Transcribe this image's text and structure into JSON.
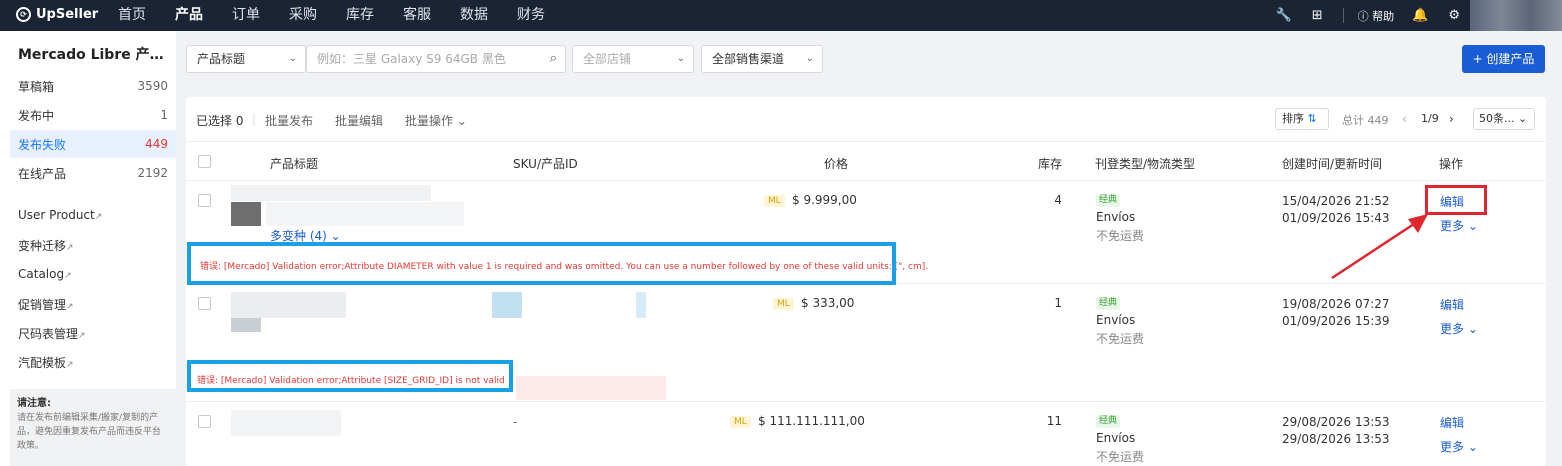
{
  "app": {
    "logo_text": "UpSeller"
  },
  "nav": {
    "items": [
      "首页",
      "产品",
      "订单",
      "采购",
      "库存",
      "客服",
      "数据",
      "财务"
    ],
    "active": "产品"
  },
  "topbar": {
    "help_label": "帮助"
  },
  "sidebar": {
    "title": "Mercado Libre 产…",
    "items": [
      {
        "label": "草稿箱",
        "count": "3590"
      },
      {
        "label": "发布中",
        "count": "1"
      },
      {
        "label": "发布失败",
        "count": "449"
      },
      {
        "label": "在线产品",
        "count": "2192"
      }
    ],
    "links": [
      "User Product",
      "变种迁移",
      "Catalog",
      "促销管理",
      "尺码表管理",
      "汽配模板"
    ],
    "notice_title": "请注意:",
    "notice_text": "请在发布前编辑采集/搬家/复制的产品，避免因重复发布产品而违反平台政策。"
  },
  "filters": {
    "field_select": "产品标题",
    "search_placeholder": "例如：三星 Galaxy S9 64GB 黑色",
    "shop_select": "全部店铺",
    "channel_select": "全部销售渠道"
  },
  "create_button": "+ 创建产品",
  "toolbar": {
    "selected_label": "已选择",
    "selected_count": "0",
    "batch_publish": "批量发布",
    "batch_edit": "批量编辑",
    "batch_ops": "批量操作",
    "sort_label": "排序",
    "total": "总计 449",
    "page": "1/9",
    "page_size": "50条..."
  },
  "table": {
    "headers": [
      "产品标题",
      "SKU/产品ID",
      "价格",
      "库存",
      "刊登类型/物流类型",
      "创建时间/更新时间",
      "操作"
    ],
    "rows": [
      {
        "ml": "ML",
        "price": "$ 9.999,00",
        "stock": "4",
        "type_tag": "经典",
        "logistics": "Envíos",
        "shipping": "不免运费",
        "created": "15/04/2026 21:52",
        "updated": "01/09/2026 15:43",
        "edit": "编辑",
        "more": "更多",
        "variants": "多变种 (4)",
        "sku": "",
        "error": "错误: [Mercado] Validation error;Attribute DIAMETER with value 1 is required and was omitted. You can use a number followed by one of these valid units: [\", cm]."
      },
      {
        "ml": "ML",
        "price": "$ 333,00",
        "stock": "1",
        "type_tag": "经典",
        "logistics": "Envíos",
        "shipping": "不免运费",
        "created": "19/08/2026 07:27",
        "updated": "01/09/2026 15:39",
        "edit": "编辑",
        "more": "更多",
        "variants": "",
        "sku": "",
        "error": "错误: [Mercado] Validation error;Attribute [SIZE_GRID_ID] is not valid"
      },
      {
        "ml": "ML",
        "price": "$ 111.111.111,00",
        "stock": "11",
        "type_tag": "经典",
        "logistics": "Envíos",
        "shipping": "不免运费",
        "created": "29/08/2026 13:53",
        "updated": "29/08/2026 13:53",
        "edit": "编辑",
        "more": "更多",
        "variants": "",
        "sku": "-",
        "error": ""
      }
    ]
  },
  "colors": {
    "topbar": "#1b2434",
    "primary": "#1a5cd6",
    "error": "#e53935",
    "highlight_box": "#1aa0e6",
    "annotation_red": "#e0262e"
  }
}
